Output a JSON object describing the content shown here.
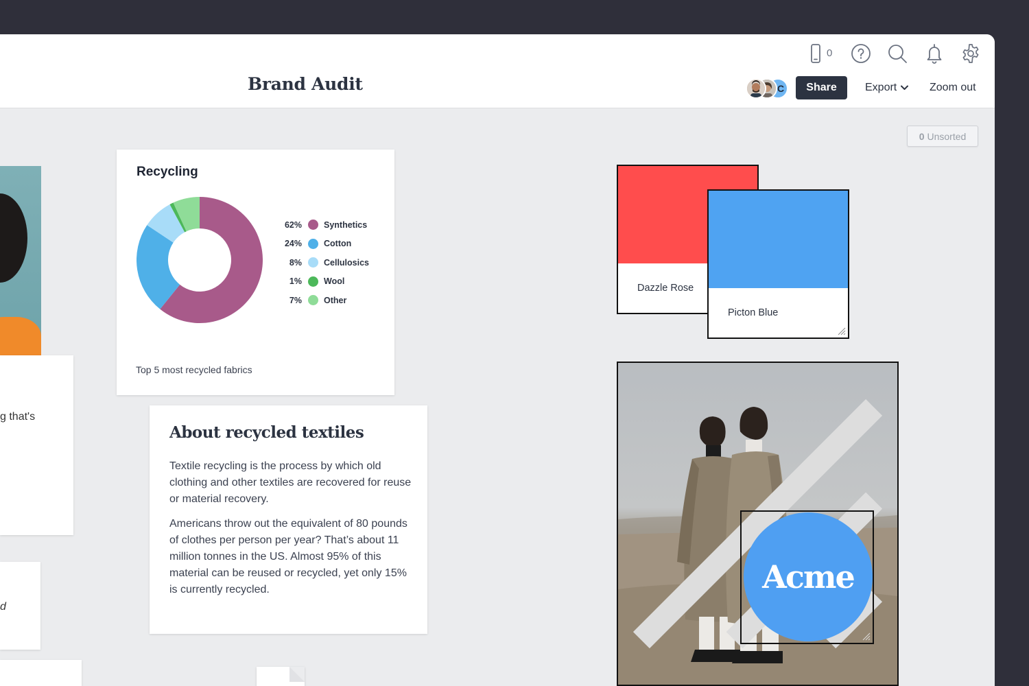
{
  "header": {
    "title": "Brand Audit",
    "device_count": "0",
    "collaborator_initial": "C",
    "share_label": "Share",
    "export_label": "Export",
    "zoom_label": "Zoom out"
  },
  "unsorted": {
    "count": "0",
    "label": "Unsorted"
  },
  "left_cards": {
    "text_fragment": "g that's",
    "note_fragment": "d"
  },
  "recycling": {
    "title": "Recycling",
    "caption": "Top 5 most recycled fabrics",
    "chart_data": {
      "type": "pie",
      "categories": [
        "Synthetics",
        "Cotton",
        "Cellulosics",
        "Wool",
        "Other"
      ],
      "values": [
        62,
        24,
        8,
        1,
        7
      ],
      "labels": [
        "62%",
        "24%",
        "8%",
        "1%",
        "7%"
      ],
      "colors": [
        "#a85a8a",
        "#4fb0e8",
        "#a8dcf8",
        "#4cb85a",
        "#8fdc98"
      ],
      "title": "Recycling"
    }
  },
  "about": {
    "title": "About recycled textiles",
    "p1": "Textile recycling is the process by which old clothing and other textiles are recovered for reuse or material recovery.",
    "p2": "Americans throw out the equivalent of 80 pounds of clothes per person per year? That’s about 11 million tonnes in the US. Almost 95% of this material can be reused or recycled, yet only 15% is currently recycled."
  },
  "swatches": [
    {
      "name": "Dazzle Rose",
      "color": "#ff4d4d"
    },
    {
      "name": "Picton Blue",
      "color": "#4fa3f2"
    }
  ],
  "logo": {
    "text": "Acme",
    "color": "#4f9ff2"
  },
  "icons": {
    "device": "mobile-device-icon",
    "help": "help-icon",
    "search": "search-icon",
    "notifications": "bell-icon",
    "settings": "gear-icon"
  }
}
